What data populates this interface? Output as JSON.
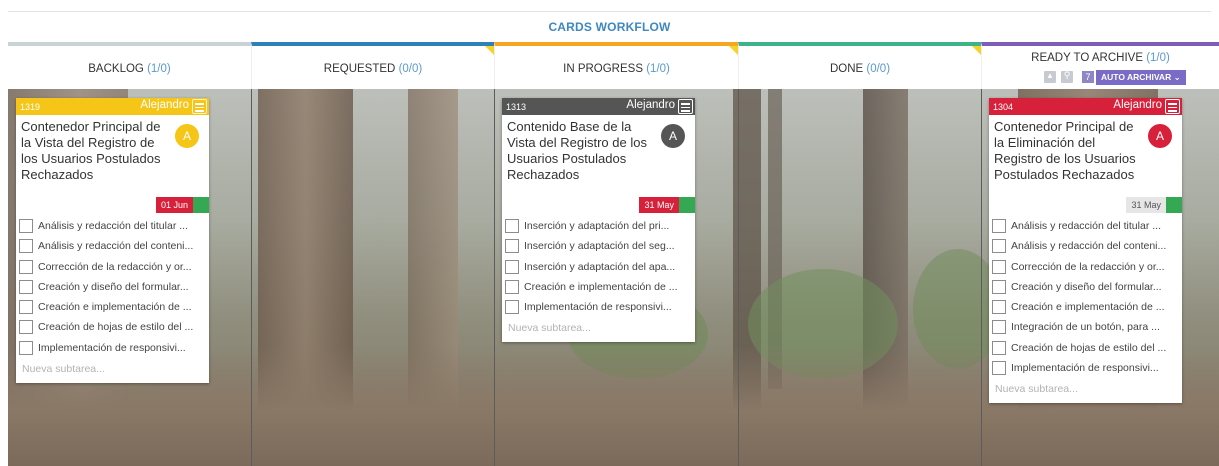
{
  "board": {
    "title": "CARDS WORKFLOW"
  },
  "columns": [
    {
      "name": "BACKLOG",
      "count": "(1/0)",
      "accent": "#c9d3d6"
    },
    {
      "name": "REQUESTED",
      "count": "(0/0)",
      "accent": "#2f80b9"
    },
    {
      "name": "IN PROGRESS",
      "count": "(1/0)",
      "accent": "#f5a623"
    },
    {
      "name": "DONE",
      "count": "(0/0)",
      "accent": "#3db38a"
    },
    {
      "name": "READY TO ARCHIVE",
      "count": "(1/0)",
      "accent": "#7c5db8"
    }
  ],
  "archive_tools": {
    "export_icon": "export-icon",
    "search_icon": "search-icon",
    "auto_count": "7",
    "auto_label": "AUTO ARCHIVAR",
    "chevron_icon": "chevron-down-icon"
  },
  "cards": [
    {
      "id": "1319",
      "owner": "Alejandro",
      "avatar": "A",
      "header_color": "#f5c518",
      "avatar_color": "#f5c518",
      "title": "Contenedor Principal de la Vista del Registro de los  Usuarios Postulados Rechazados",
      "date": "01 Jun",
      "date_bg": "#d7213b",
      "date_fg": "#ffffff",
      "subtasks": [
        "Análisis y redacción del titular ...",
        "Análisis y redacción del conteni...",
        "Corrección de la redacción y or...",
        "Creación y diseño del formular...",
        "Creación e implementación de ...",
        "Creación de hojas de estilo del ...",
        "Implementación de responsivi..."
      ],
      "new_subtask": "Nueva subtarea..."
    },
    {
      "id": "1313",
      "owner": "Alejandro",
      "avatar": "A",
      "header_color": "#555555",
      "avatar_color": "#555555",
      "title": "Contenido Base de la Vista del Registro de los Usuarios Postulados Rechazados",
      "date": "31 May",
      "date_bg": "#d7213b",
      "date_fg": "#ffffff",
      "subtasks": [
        "Inserción y adaptación del pri...",
        "Inserción y adaptación del seg...",
        "Inserción y adaptación del apa...",
        "Creación e implementación de ...",
        "Implementación de responsivi..."
      ],
      "new_subtask": "Nueva subtarea..."
    },
    {
      "id": "1304",
      "owner": "Alejandro",
      "avatar": "A",
      "header_color": "#d7213b",
      "avatar_color": "#d7213b",
      "title": "Contenedor Principal de la Eliminación del Registro de los  Usuarios Postulados Rechazados",
      "date": "31 May",
      "date_bg": "#e6e6e6",
      "date_fg": "#555555",
      "subtasks": [
        "Análisis y redacción del titular ...",
        "Análisis y redacción del conteni...",
        "Corrección de la redacción y or...",
        "Creación y diseño del formular...",
        "Creación e implementación de ...",
        "Integración de un botón, para ...",
        "Creación de hojas de estilo del ...",
        "Implementación de responsivi..."
      ],
      "new_subtask": "Nueva subtarea..."
    }
  ]
}
